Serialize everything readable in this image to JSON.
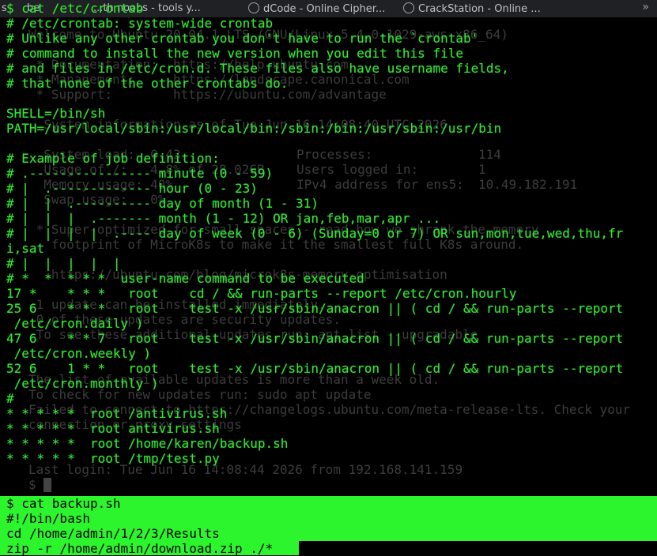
{
  "browser_tabs": [
    {
      "label": "s"
    },
    {
      "label": "be"
    },
    {
      "label": "...th noobs - tools y..."
    },
    {
      "label": "dCode - Online Cipher..."
    },
    {
      "label": "CrackStation - Online ..."
    }
  ],
  "tab_overflow_icon": "chevrons-right-icon",
  "background_terminal": {
    "lines": [
      "Welcome to Ubuntu 20.04.1 LTS (GNU/Linux 5.4.0-1029-aws x86_64)",
      " * Documentation:  https://help.ubuntu.com",
      " * Management:     https://landscape.canonical.com",
      " * Support:        https://ubuntu.com/advantage",
      "  System information as of Tue Jun 16 14:08:40 UTC 2026",
      "  System load:  0.43",
      "  Usage of /:   4.8% of 28.02GB",
      "  Memory usage: 40%",
      "  Swap usage:   0%",
      " * Super-optimized for small spaces - read how we shrank the memory",
      "   footprint of MicroK8s to make it the smallest full K8s around.",
      "   https://ubuntu.com/blog/microk8s-memory-optimisation",
      " 1 update can be installed immediately.",
      " 0 of these updates are security updates.",
      " To see these additional updates run: apt list --upgradable",
      "The list of available updates is more than a week old.",
      "To check for new updates run: sudo apt update",
      "Failed to connect to https://changelogs.ubuntu.com/meta-release-lts. Check your",
      "connection or proxy settings",
      "Last login: Tue Jun 16 14:08:44 2026 from 192.168.141.159",
      "$"
    ],
    "stats": [
      {
        "label": "Processes:",
        "value": "114"
      },
      {
        "label": "Users logged in:",
        "value": "1"
      },
      {
        "label": "IPv4 address for ens5:",
        "value": "10.49.182.191"
      }
    ]
  },
  "crontab_terminal": {
    "lines": [
      "$ cat /etc/crontab",
      "# /etc/crontab: system-wide crontab",
      "# Unlike any other crontab you don't have to run the `crontab'",
      "# command to install the new version when you edit this file",
      "# and files in /etc/cron.d. These files also have username fields,",
      "# that none of the other crontabs do.",
      "",
      "SHELL=/bin/sh",
      "PATH=/usr/local/sbin:/usr/local/bin:/sbin:/bin:/usr/sbin:/usr/bin",
      "",
      "# Example of job definition:",
      "# .---------------- minute (0 - 59)",
      "# |  .------------- hour (0 - 23)",
      "# |  |  .---------- day of month (1 - 31)",
      "# |  |  |  .------- month (1 - 12) OR jan,feb,mar,apr ...",
      "# |  |  |  |  .---- day of week (0 - 6) (Sunday=0 or 7) OR sun,mon,tue,wed,thu,fr",
      "i,sat",
      "# |  |  |  |  |",
      "# *  *  * * *  user-name command to be executed",
      "17 *    * * *   root    cd / && run-parts --report /etc/cron.hourly",
      "25 6    * * *   root    test -x /usr/sbin/anacron || ( cd / && run-parts --report",
      " /etc/cron.daily )",
      "47 6    * * 7   root    test -x /usr/sbin/anacron || ( cd / && run-parts --report",
      " /etc/cron.weekly )",
      "52 6    1 * *   root    test -x /usr/sbin/anacron || ( cd / && run-parts --report",
      " /etc/cron.monthly )",
      "#",
      "* * * * *  root /antivirus.sh",
      "* * * * *  root antivirus.sh",
      "* * * * *  root /home/karen/backup.sh",
      "* * * * *  root /tmp/test.py"
    ]
  },
  "backup_panel": {
    "lines": [
      "$ cat backup.sh",
      "#!/bin/bash",
      "cd /home/admin/1/2/3/Results",
      "zip -r /home/admin/download.zip ./*"
    ]
  }
}
